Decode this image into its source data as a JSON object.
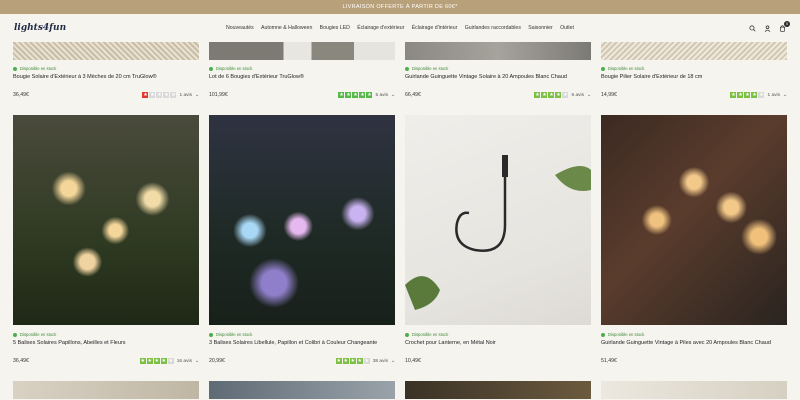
{
  "promo": "LIVRAISON OFFERTE À PARTIR DE 60€*",
  "logo": "lights4fun",
  "nav": [
    "Nouveautés",
    "Automne & Halloween",
    "Bougies LED",
    "Éclairage d'extérieur",
    "Éclairage d'intérieur",
    "Guirlandes raccordables",
    "Saisonnier",
    "Outlet"
  ],
  "cart_count": "0",
  "stock_label": "Disponible en stock",
  "products": [
    {
      "title": "Bougie Solaire d'Extérieur à 3 Mèches de 20 cm TruGlow®",
      "price": "36,49€",
      "reviews": "1 avis",
      "rating": 1,
      "star_color": "#e2362f"
    },
    {
      "title": "Lot de 6 Bougies d'Extérieur TruGlow®",
      "price": "101,99€",
      "reviews": "5 avis",
      "rating": 5,
      "star_color": "#56b847"
    },
    {
      "title": "Guirlande Guinguette Vintage Solaire à 20 Ampoules Blanc Chaud",
      "price": "66,49€",
      "reviews": "6 avis",
      "rating": 4,
      "star_color": "#7bc043"
    },
    {
      "title": "Bougie Pilier Solaire d'Extérieur de 18 cm",
      "price": "14,99€",
      "reviews": "1 avis",
      "rating": 4,
      "star_color": "#7bc043"
    },
    {
      "title": "5 Balises Solaires Papillons, Abeilles et Fleurs",
      "price": "36,49€",
      "reviews": "16 avis",
      "rating": 4,
      "star_color": "#7bc043"
    },
    {
      "title": "3 Balises Solaires Libellule, Papillon et Colibri à Couleur Changeante",
      "price": "20,99€",
      "reviews": "38 avis",
      "rating": 4,
      "star_color": "#7bc043"
    },
    {
      "title": "Crochet pour Lanterne, en Métal Noir",
      "price": "10,49€",
      "reviews": "",
      "rating": 0,
      "star_color": "#7bc043"
    },
    {
      "title": "Guirlande Guinguette Vintage à Piles avec 20 Ampoules Blanc Chaud",
      "price": "51,49€",
      "reviews": "",
      "rating": 0,
      "star_color": "#7bc043"
    }
  ]
}
